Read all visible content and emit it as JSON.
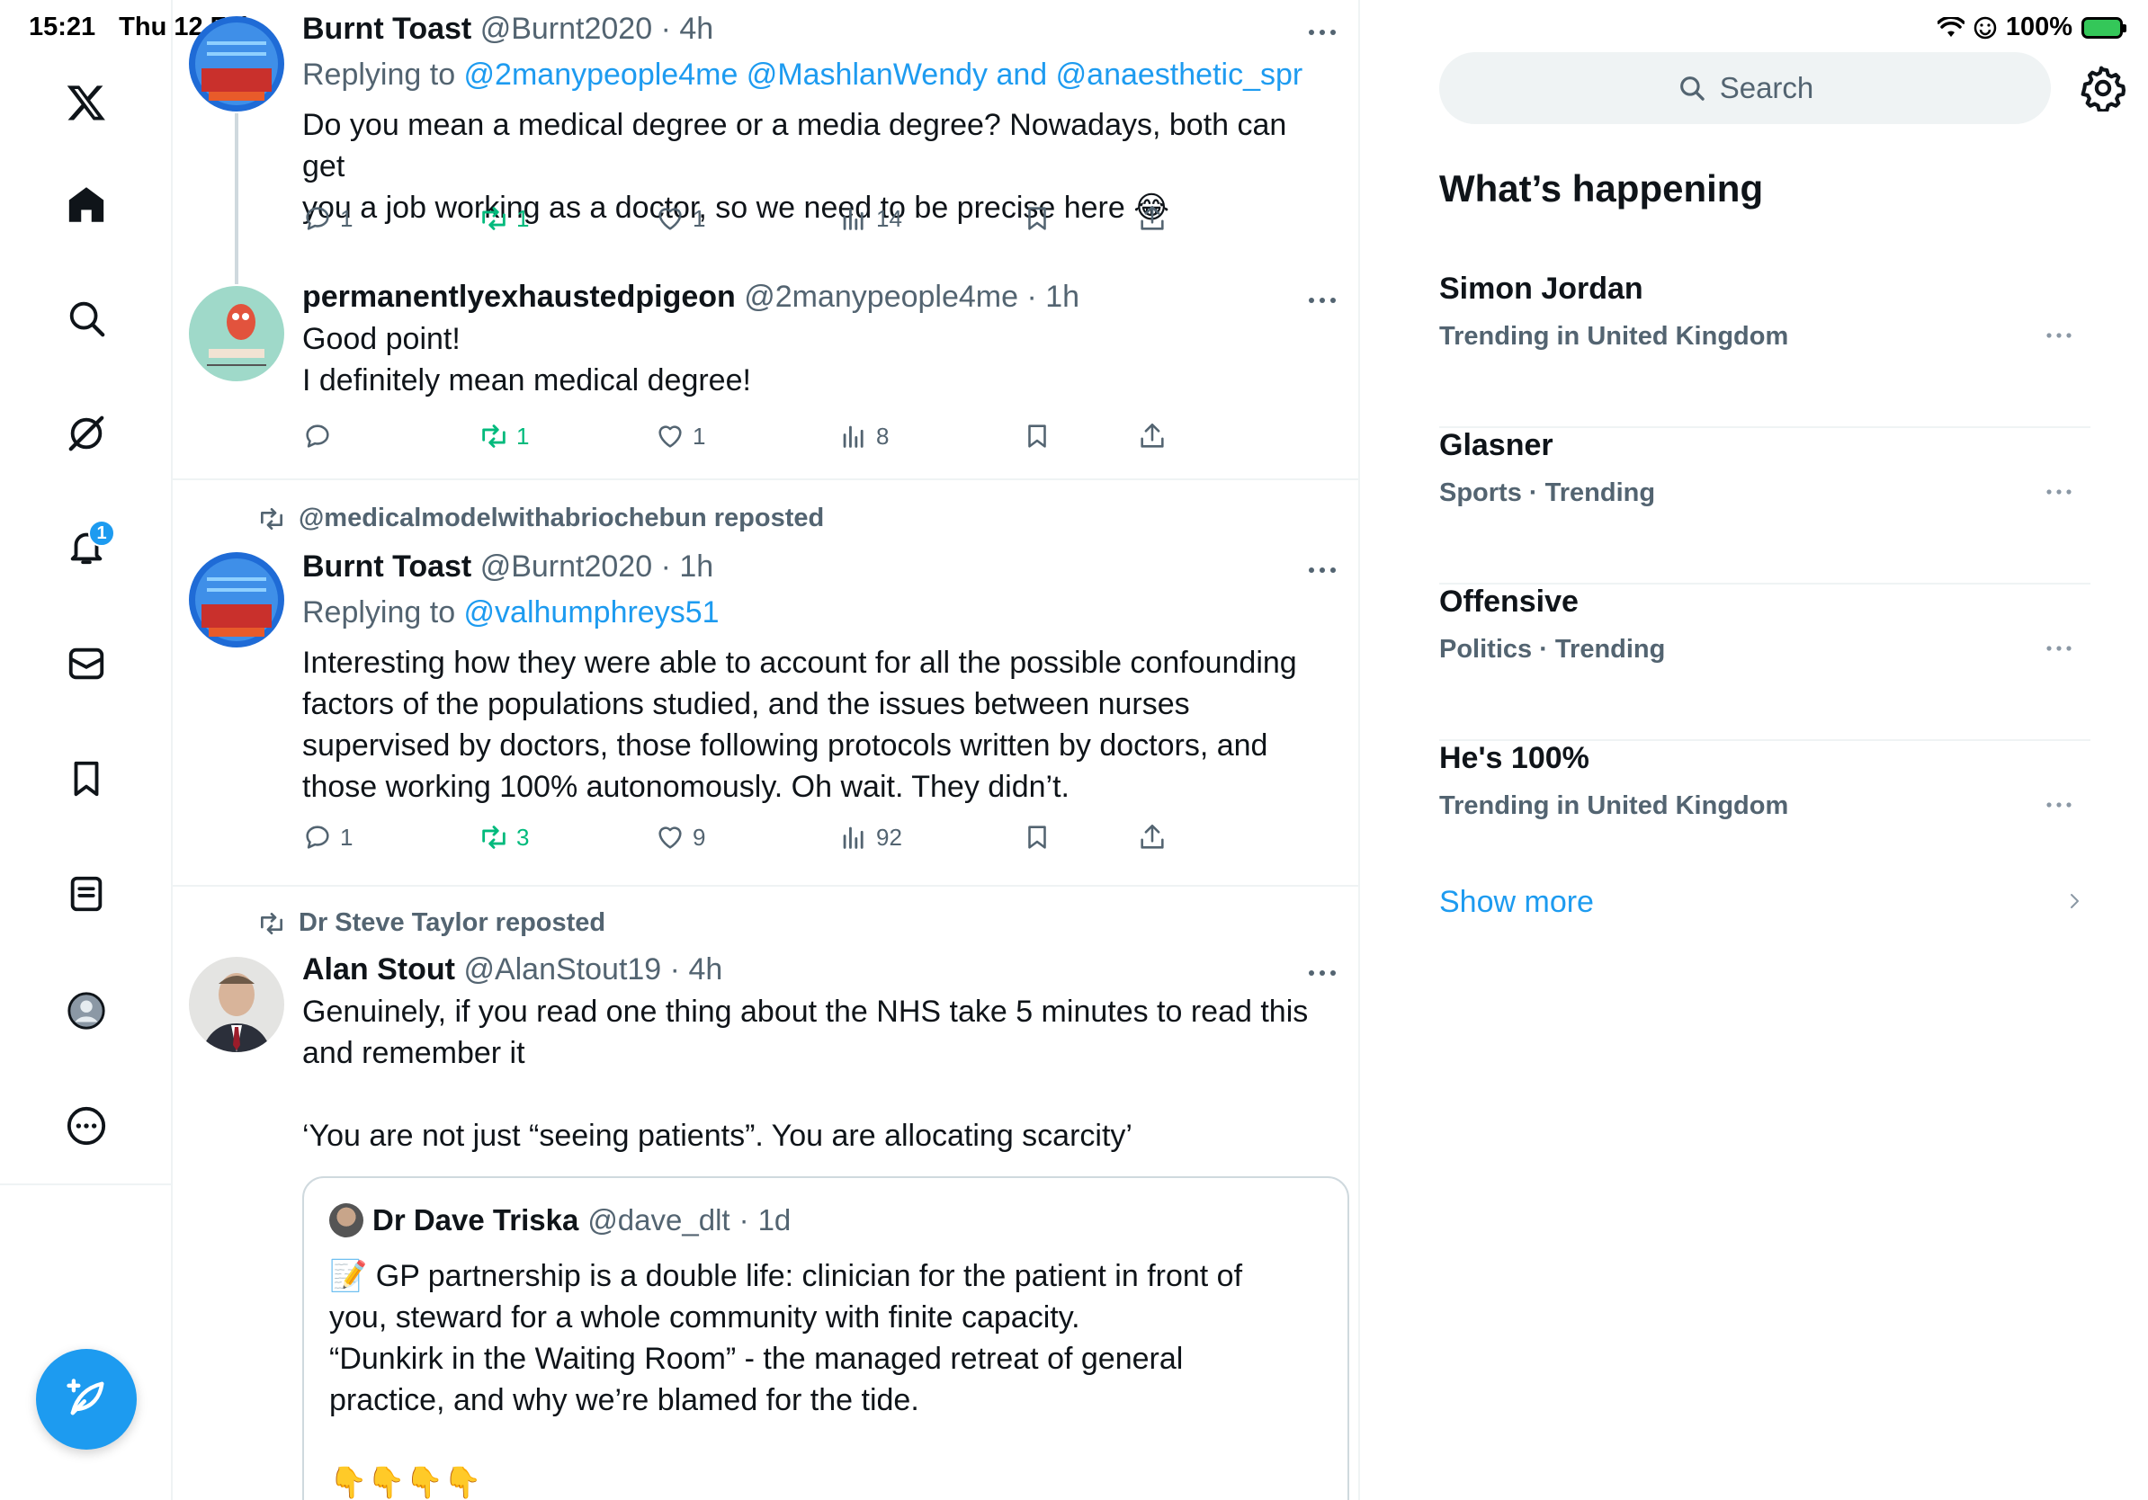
{
  "status_bar": {
    "time": "15:21",
    "date": "Thu 12 Feb",
    "battery": "100%"
  },
  "nav": {
    "notification_count": "1"
  },
  "posts": [
    {
      "name": "Burnt Toast",
      "handle": "@Burnt2020",
      "time": "4h",
      "replying_prefix": "Replying to ",
      "replying_to": "@2manypeople4me @MashlanWendy and @anaesthetic_spr",
      "text": "Do you mean a medical degree or a media degree? Nowadays, both can get\nyou a job working as a doctor, so we need to be precise here 😂",
      "stats": {
        "replies": "1",
        "reposts": "1",
        "likes": "1",
        "views": "14"
      }
    },
    {
      "name": "permanentlyexhaustedpigeon",
      "handle": "@2manypeople4me",
      "time": "1h",
      "text": "Good point!\nI definitely mean medical degree!",
      "stats": {
        "replies": "",
        "reposts": "1",
        "likes": "1",
        "views": "8"
      }
    },
    {
      "reposted_by": "@medicalmodelwithabriochebun reposted",
      "name": "Burnt Toast",
      "handle": "@Burnt2020",
      "time": "1h",
      "replying_prefix": "Replying to ",
      "replying_to": "@valhumphreys51",
      "text": "Interesting how they were able to account for all the possible confounding\nfactors of the populations studied, and the issues between nurses\nsupervised by doctors, those following protocols written by doctors, and\nthose working 100% autonomously. Oh wait. They didn’t.",
      "stats": {
        "replies": "1",
        "reposts": "3",
        "likes": "9",
        "views": "92"
      }
    },
    {
      "reposted_by": "Dr Steve Taylor reposted",
      "name": "Alan Stout",
      "handle": "@AlanStout19",
      "time": "4h",
      "text": "Genuinely, if you read one thing about the NHS take 5 minutes to read this\nand remember it\n\n‘You are not just “seeing patients”. You are allocating scarcity’",
      "quote": {
        "name": "Dr Dave Triska",
        "handle": "@dave_dlt",
        "time": "1d",
        "text": "📝 GP partnership is a double life: clinician for the patient in front of\nyou, steward for a whole community with finite capacity.\n“Dunkirk in the Waiting Room” - the managed retreat of general\npractice, and why we’re blamed for the tide.\n\n👇👇👇👇"
      }
    }
  ],
  "sidebar": {
    "search_placeholder": "Search",
    "title": "What’s happening",
    "trends": [
      {
        "name": "Simon Jordan",
        "meta": "Trending in United Kingdom"
      },
      {
        "name": "Glasner",
        "meta": "Sports · Trending"
      },
      {
        "name": "Offensive",
        "meta": "Politics · Trending"
      },
      {
        "name": "He's 100%",
        "meta": "Trending in United Kingdom"
      }
    ],
    "show_more": "Show more"
  },
  "colors": {
    "accent": "#1d9bf0",
    "retweet": "#00ba7c",
    "muted": "#536471",
    "text": "#0f1419"
  }
}
